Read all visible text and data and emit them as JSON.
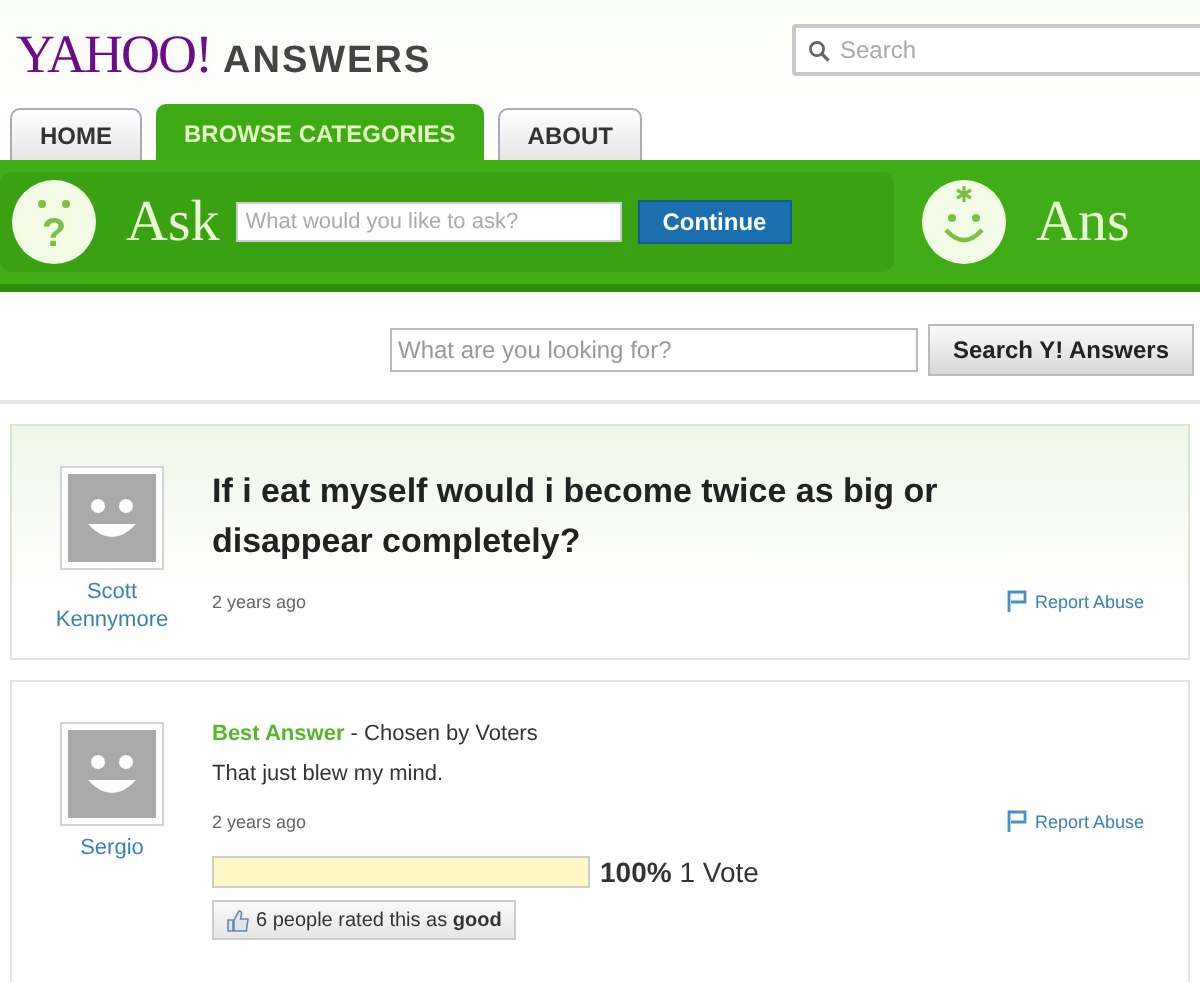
{
  "header": {
    "logo_brand": "YAHOO!",
    "logo_product": "ANSWERS",
    "search": {
      "placeholder": "Search"
    }
  },
  "tabs": [
    {
      "label": "HOME",
      "selected": false
    },
    {
      "label": "BROWSE CATEGORIES",
      "selected": true
    },
    {
      "label": "ABOUT",
      "selected": false
    }
  ],
  "ask_bar": {
    "icon_glyph": "?",
    "label": "Ask",
    "placeholder": "What would you like to ask?",
    "button": "Continue",
    "answer_label": "Ans"
  },
  "search_bar": {
    "placeholder": "What are you looking for?",
    "button": "Search Y! Answers"
  },
  "question": {
    "author": "Scott Kennymore",
    "text": "If i eat myself would i become twice as big or disappear completely?",
    "time": "2 years ago",
    "report": "Report Abuse"
  },
  "answer": {
    "badge": "Best Answer",
    "chosen": "- Chosen by Voters",
    "author": "Sergio",
    "text": "That just blew my mind.",
    "time": "2 years ago",
    "report": "Report Abuse",
    "vote": {
      "level": 1,
      "percent": "100%",
      "votes": "1 Vote"
    },
    "rating": "6 people rated this as **good**"
  }
}
